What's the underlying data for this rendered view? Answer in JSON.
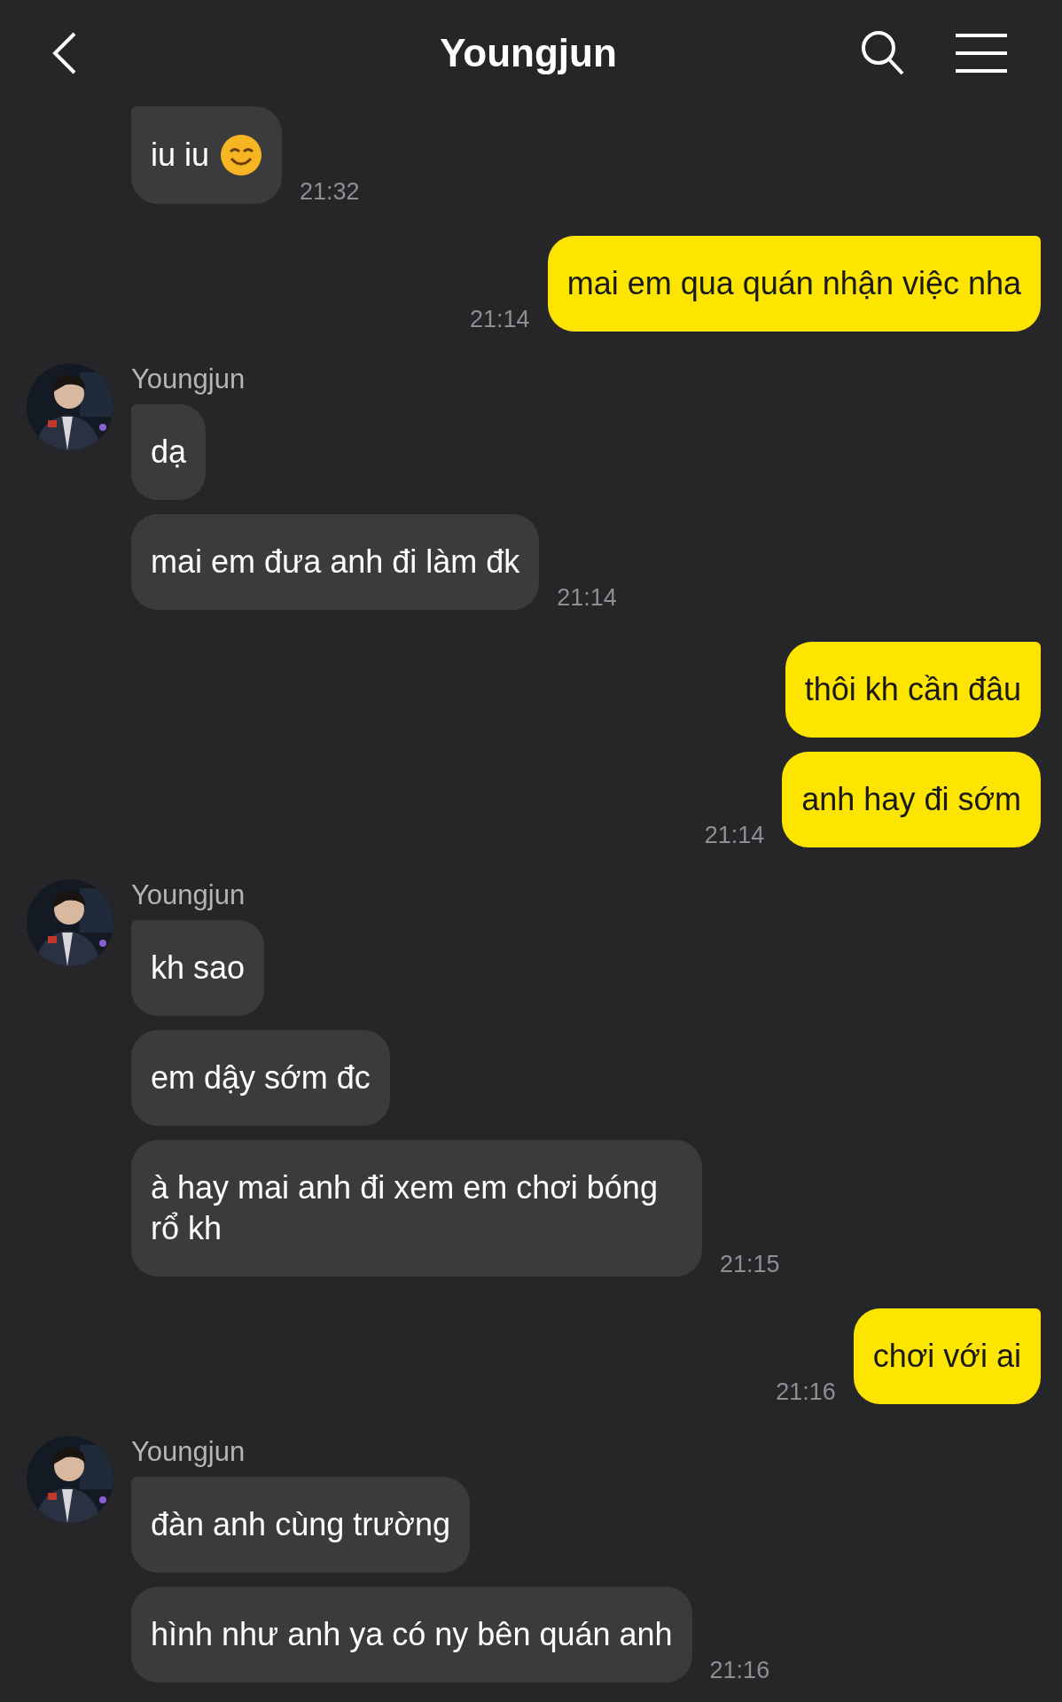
{
  "header": {
    "title": "Youngjun"
  },
  "groups": [
    {
      "kind": "incoming",
      "bubbles": [
        {
          "kind": "emoji_text",
          "text": "iu iu"
        }
      ],
      "time": "21:32"
    },
    {
      "kind": "outgoing",
      "bubbles": [
        {
          "kind": "text",
          "text": "mai em qua quán nhận việc nha"
        }
      ],
      "time": "21:14"
    },
    {
      "kind": "incoming",
      "sender": "Youngjun",
      "bubbles": [
        {
          "kind": "text",
          "text": "dạ"
        },
        {
          "kind": "text",
          "text": "mai em đưa anh đi làm đk"
        }
      ],
      "time": "21:14"
    },
    {
      "kind": "outgoing",
      "bubbles": [
        {
          "kind": "text",
          "text": "thôi kh cần đâu"
        },
        {
          "kind": "text",
          "text": "anh hay đi sớm"
        }
      ],
      "time": "21:14"
    },
    {
      "kind": "incoming",
      "sender": "Youngjun",
      "bubbles": [
        {
          "kind": "text",
          "text": "kh sao"
        },
        {
          "kind": "text",
          "text": "em dậy sớm đc"
        },
        {
          "kind": "text",
          "text": "à hay mai anh đi xem em chơi bóng rổ kh"
        }
      ],
      "time": "21:15"
    },
    {
      "kind": "outgoing",
      "bubbles": [
        {
          "kind": "text",
          "text": "chơi với ai"
        }
      ],
      "time": "21:16"
    },
    {
      "kind": "incoming",
      "sender": "Youngjun",
      "bubbles": [
        {
          "kind": "text",
          "text": "đàn anh cùng trường"
        },
        {
          "kind": "text",
          "text": "hình như anh ya có ny bên quán anh"
        }
      ],
      "time": "21:16"
    }
  ]
}
